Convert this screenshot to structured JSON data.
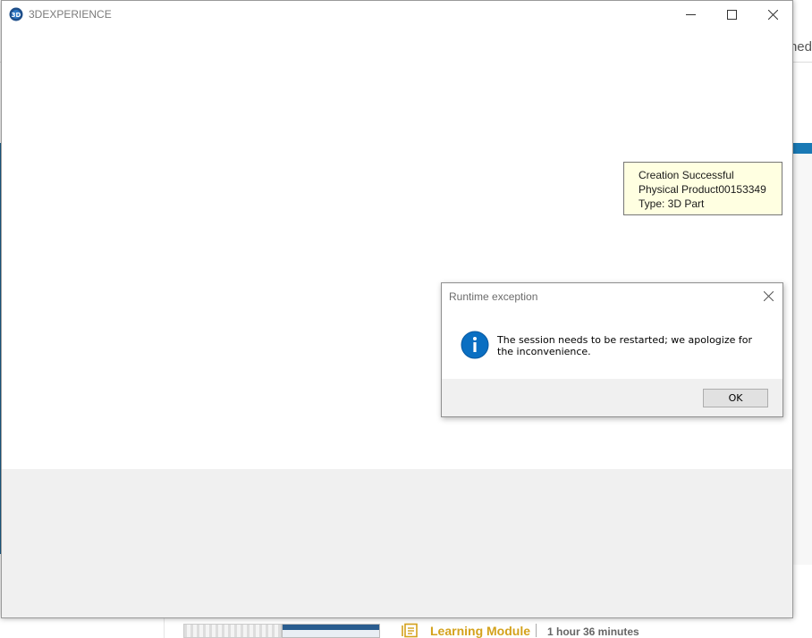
{
  "background": {
    "tab_text": "ned",
    "module": {
      "title": "Learning Module",
      "duration": "1 hour 36 minutes"
    }
  },
  "window": {
    "title": "3DEXPERIENCE",
    "icons": {
      "logo": "3dexperience-compass-icon",
      "minimize": "minimize-icon",
      "maximize": "maximize-icon",
      "close": "close-icon"
    }
  },
  "tooltip": {
    "line1": "Creation Successful",
    "line2": "Physical Product00153349",
    "line3": "Type: 3D Part"
  },
  "dialog": {
    "title": "Runtime exception",
    "message": "The session needs to be restarted; we apologize for the inconvenience.",
    "ok_label": "OK",
    "icon": "info-icon"
  },
  "colors": {
    "accent_blue": "#1979b5",
    "info_icon_blue": "#0a6fc2",
    "tooltip_bg": "#ffffe1",
    "module_gold": "#d4a21c"
  }
}
